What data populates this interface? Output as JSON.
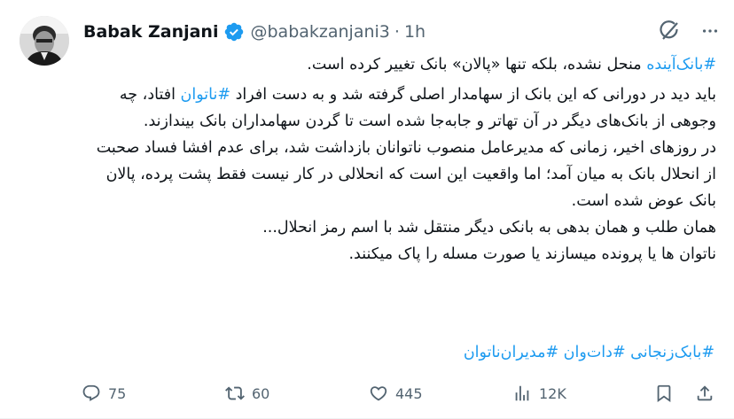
{
  "author": {
    "name": "Babak Zanjani",
    "handle": "@babakzanjani3",
    "separator": "·",
    "time": "1h"
  },
  "tweet": {
    "line1_hashtag": "#بانک‌آینده",
    "line1_text": " منحل نشده، بلکه تنها «پالان» بانک تغییر کرده است.",
    "para2_before": "باید دید در دورانی که این بانک از سهامدار اصلی گرفته شد و به دست افراد ",
    "para2_hashtag": "#ناتوان",
    "para2_after": " افتاد، چه وجوهی از بانک‌های دیگر در آن تهاتر و جابه‌جا شده است تا گردن سهامداران بانک بیندازند.",
    "para3": "در روزهای اخیر، زمانی که مدیرعامل منصوب ناتوانان بازداشت شد، برای عدم افشا فساد صحبت از انحلال بانک به میان آمد؛ اما واقعیت این است که انحلالی در کار نیست فقط پشت پرده، پالان بانک عوض شده است.",
    "para4": "همان طلب و همان بدهی به بانکی دیگر منتقل شد  با اسم رمز انحلال...",
    "para5": "ناتوان ها یا پرونده میسازند یا صورت مسله را پاک میکنند.",
    "tags": "#بابک‌زنجانی #دات‌وان #مدیران‌ناتوان"
  },
  "actions": {
    "replies": "75",
    "reposts": "60",
    "likes": "445",
    "views": "12K"
  },
  "icons": [
    "verified-icon",
    "grok-icon",
    "more-icon",
    "reply-icon",
    "repost-icon",
    "like-icon",
    "views-icon",
    "bookmark-icon",
    "share-icon"
  ],
  "colors": {
    "accent": "#1d9bf0",
    "muted": "#536471",
    "text": "#0f1419"
  }
}
